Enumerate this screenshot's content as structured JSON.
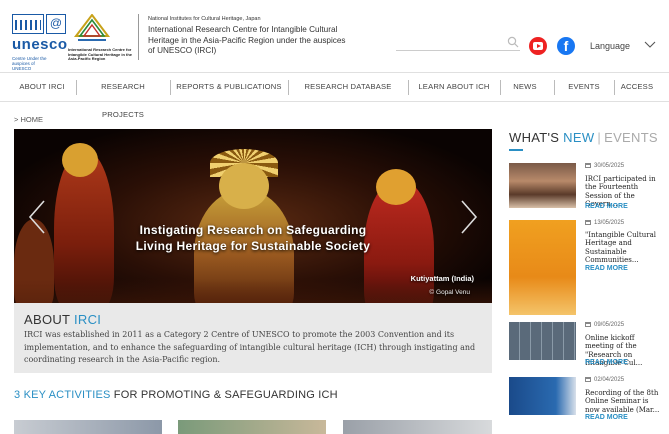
{
  "header": {
    "unesco_word": "unesco",
    "unesco_sub": "Centre Under the auspices of UNESCO",
    "irci_sub": "International Research Centre for Intangible Cultural Heritage in the Asia-Pacific Region",
    "org_jp": "National Institutes for Cultural Heritage, Japan",
    "org_name": "International Research Centre for Intangible Cultural Heritage in the Asia-Pacific Region under the auspices of UNESCO (IRCI)",
    "language_label": "Language"
  },
  "nav": {
    "items": [
      {
        "label": "ABOUT IRCI"
      },
      {
        "label": "RESEARCH PROJECTS"
      },
      {
        "label": "REPORTS & PUBLICATIONS"
      },
      {
        "label": "RESEARCH DATABASE"
      },
      {
        "label": "LEARN ABOUT ICH"
      },
      {
        "label": "NEWS"
      },
      {
        "label": "EVENTS"
      },
      {
        "label": "ACCESS"
      }
    ]
  },
  "breadcrumb": "> HOME",
  "hero": {
    "title_line1": "Instigating Research on Safeguarding",
    "title_line2": "Living Heritage for Sustainable Society",
    "caption": "Kutiyattam (India)",
    "credit": "© Gopal Venu"
  },
  "about": {
    "title_plain": "ABOUT ",
    "title_accent": "IRCI",
    "body": "IRCI was established in 2011 as a Category 2 Centre of UNESCO to promote the 2003 Convention and its implementation, and to enhance the safeguarding of intangible cultural heritage (ICH) through instigating and coordinating research in the Asia-Pacific region."
  },
  "key_activities": {
    "accent": "3 KEY ACTIVITIES",
    "plain": " FOR PROMOTING & SAFEGUARDING ICH"
  },
  "sidebar": {
    "heading_a": "WHAT'S ",
    "heading_b": "NEW",
    "heading_sep": "|",
    "heading_c": "EVENTS",
    "read_more": "READ MORE",
    "news": [
      {
        "date": "30/05/2025",
        "title": "IRCI participated in the Fourteenth Session of the Govern..."
      },
      {
        "date": "13/05/2025",
        "title": "\"Intangible Cultural Heritage and Sustainable Communities..."
      },
      {
        "date": "09/05/2025",
        "title": "Online kickoff meeting of the \"Research on Intangible Cul..."
      },
      {
        "date": "02/04/2025",
        "title": "Recording of the 8th Online Seminar is now available (Mar..."
      }
    ]
  },
  "colors": {
    "accent": "#2a8fc4",
    "unesco_blue": "#1a5aa6",
    "about_bg": "#e9e9e9"
  }
}
